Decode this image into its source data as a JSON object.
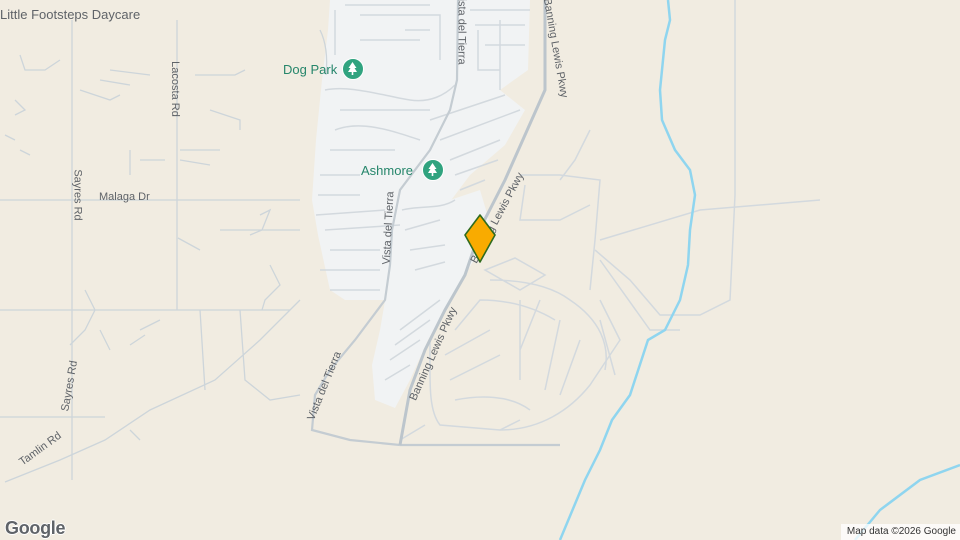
{
  "map": {
    "places": {
      "daycare": "Little Footsteps Daycare",
      "dog_park": "Dog Park",
      "ashmore": "Ashmore"
    },
    "streets": {
      "lacosta_rd": "Lacosta Rd",
      "malaga_dr": "Malaga Dr",
      "sayres_rd_upper": "Sayres Rd",
      "sayres_rd_lower": "Sayres Rd",
      "tamlin_rd": "Tamlin Rd",
      "vista_del_tierra_top": "Vista del Tierra",
      "vista_del_tierra_mid": "Vista del Tierra",
      "vista_del_tierra_low": "Vista del Tierra",
      "banning_lewis_pkwy_top": "Banning Lewis Pkwy",
      "banning_lewis_pkwy_mid": "Banning Lewis Pkwy",
      "banning_lewis_pkwy_low": "Banning Lewis Pkwy"
    },
    "icons": {
      "poi": "tree-icon",
      "pin": "location-pin-icon"
    },
    "colors": {
      "land": "#f1ece1",
      "developed": "#f1f3f4",
      "water": "#8fd5ef",
      "road": "#cdd5da",
      "poi_text": "#26866b",
      "pin_fill": "#f9ab00",
      "pin_stroke": "#2f6b1e"
    }
  },
  "logo": "Google",
  "attribution": "Map data ©2026 Google"
}
